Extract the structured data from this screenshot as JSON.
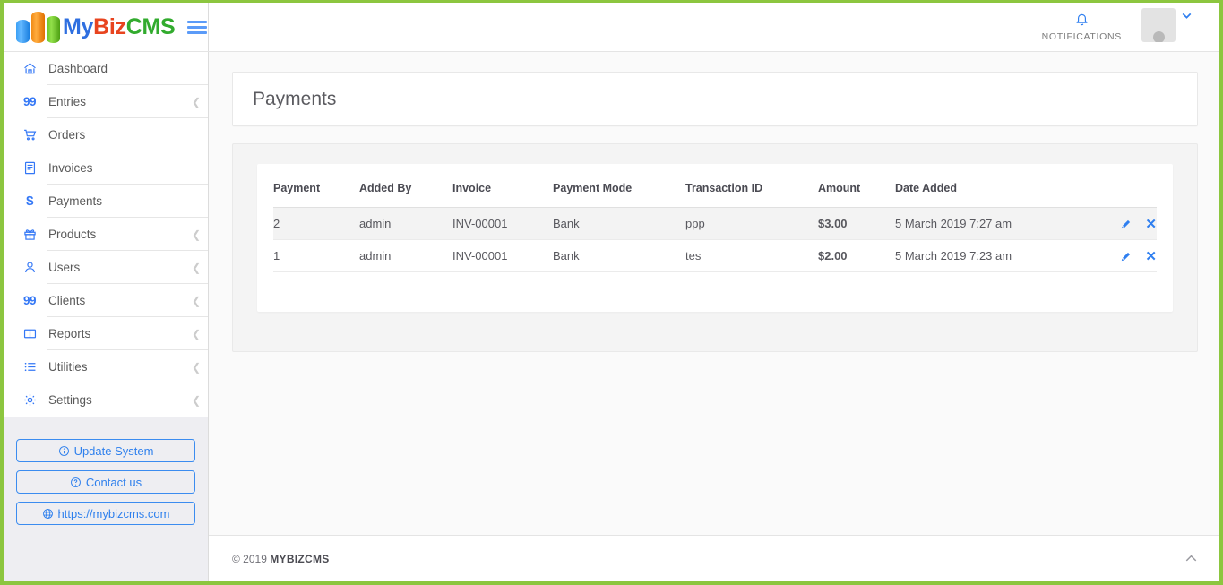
{
  "brand": {
    "name_my": "My",
    "name_biz": "Biz",
    "name_cms": "CMS",
    "logo_icon": "bar-chart-logo-icon",
    "menu_toggle_icon": "hamburger-icon"
  },
  "topbar": {
    "notifications_label": "NOTIFICATIONS",
    "notifications_icon": "bell-icon",
    "avatar_icon": "user-avatar-icon",
    "user_caret_icon": "chevron-down-icon"
  },
  "sidebar": {
    "items": [
      {
        "label": "Dashboard",
        "icon": "home-icon",
        "glyph": "",
        "has_children": false
      },
      {
        "label": "Entries",
        "icon": "number-icon",
        "glyph": "99",
        "has_children": true
      },
      {
        "label": "Orders",
        "icon": "cart-icon",
        "glyph": "",
        "has_children": false
      },
      {
        "label": "Invoices",
        "icon": "invoice-icon",
        "glyph": "",
        "has_children": false
      },
      {
        "label": "Payments",
        "icon": "dollar-icon",
        "glyph": "$",
        "has_children": false
      },
      {
        "label": "Products",
        "icon": "gift-icon",
        "glyph": "",
        "has_children": true
      },
      {
        "label": "Users",
        "icon": "user-icon",
        "glyph": "",
        "has_children": true
      },
      {
        "label": "Clients",
        "icon": "number-icon",
        "glyph": "99",
        "has_children": true
      },
      {
        "label": "Reports",
        "icon": "book-icon",
        "glyph": "",
        "has_children": true
      },
      {
        "label": "Utilities",
        "icon": "list-icon",
        "glyph": "",
        "has_children": true
      },
      {
        "label": "Settings",
        "icon": "gear-icon",
        "glyph": "",
        "has_children": true
      }
    ],
    "buttons": [
      {
        "label": "Update System",
        "icon": "info-circle-icon"
      },
      {
        "label": "Contact us",
        "icon": "question-circle-icon"
      },
      {
        "label": "https://mybizcms.com",
        "icon": "globe-icon"
      }
    ]
  },
  "main": {
    "page_title": "Payments",
    "table": {
      "columns": [
        "Payment",
        "Added By",
        "Invoice",
        "Payment Mode",
        "Transaction ID",
        "Amount",
        "Date Added"
      ],
      "rows": [
        {
          "payment": "2",
          "added_by": "admin",
          "invoice": "INV-00001",
          "payment_mode": "Bank",
          "transaction_id": "ppp",
          "amount": "$3.00",
          "date_added": "5 March 2019 7:27 am",
          "edit_icon": "pencil-icon",
          "delete_icon": "close-x-icon"
        },
        {
          "payment": "1",
          "added_by": "admin",
          "invoice": "INV-00001",
          "payment_mode": "Bank",
          "transaction_id": "tes",
          "amount": "$2.00",
          "date_added": "5 March 2019 7:23 am",
          "edit_icon": "pencil-icon",
          "delete_icon": "close-x-icon"
        }
      ]
    }
  },
  "footer": {
    "copyright_prefix": "© 2019 ",
    "copyright_brand": "MYBIZCMS",
    "scroll_top_icon": "chevron-up-icon"
  },
  "colors": {
    "accent_blue": "#2f80ed",
    "icon_blue": "#3377f6",
    "border_green": "#8cc63f",
    "logo_blue": "#2f6fe0",
    "logo_red": "#e8441f",
    "logo_green": "#32ab2e"
  }
}
